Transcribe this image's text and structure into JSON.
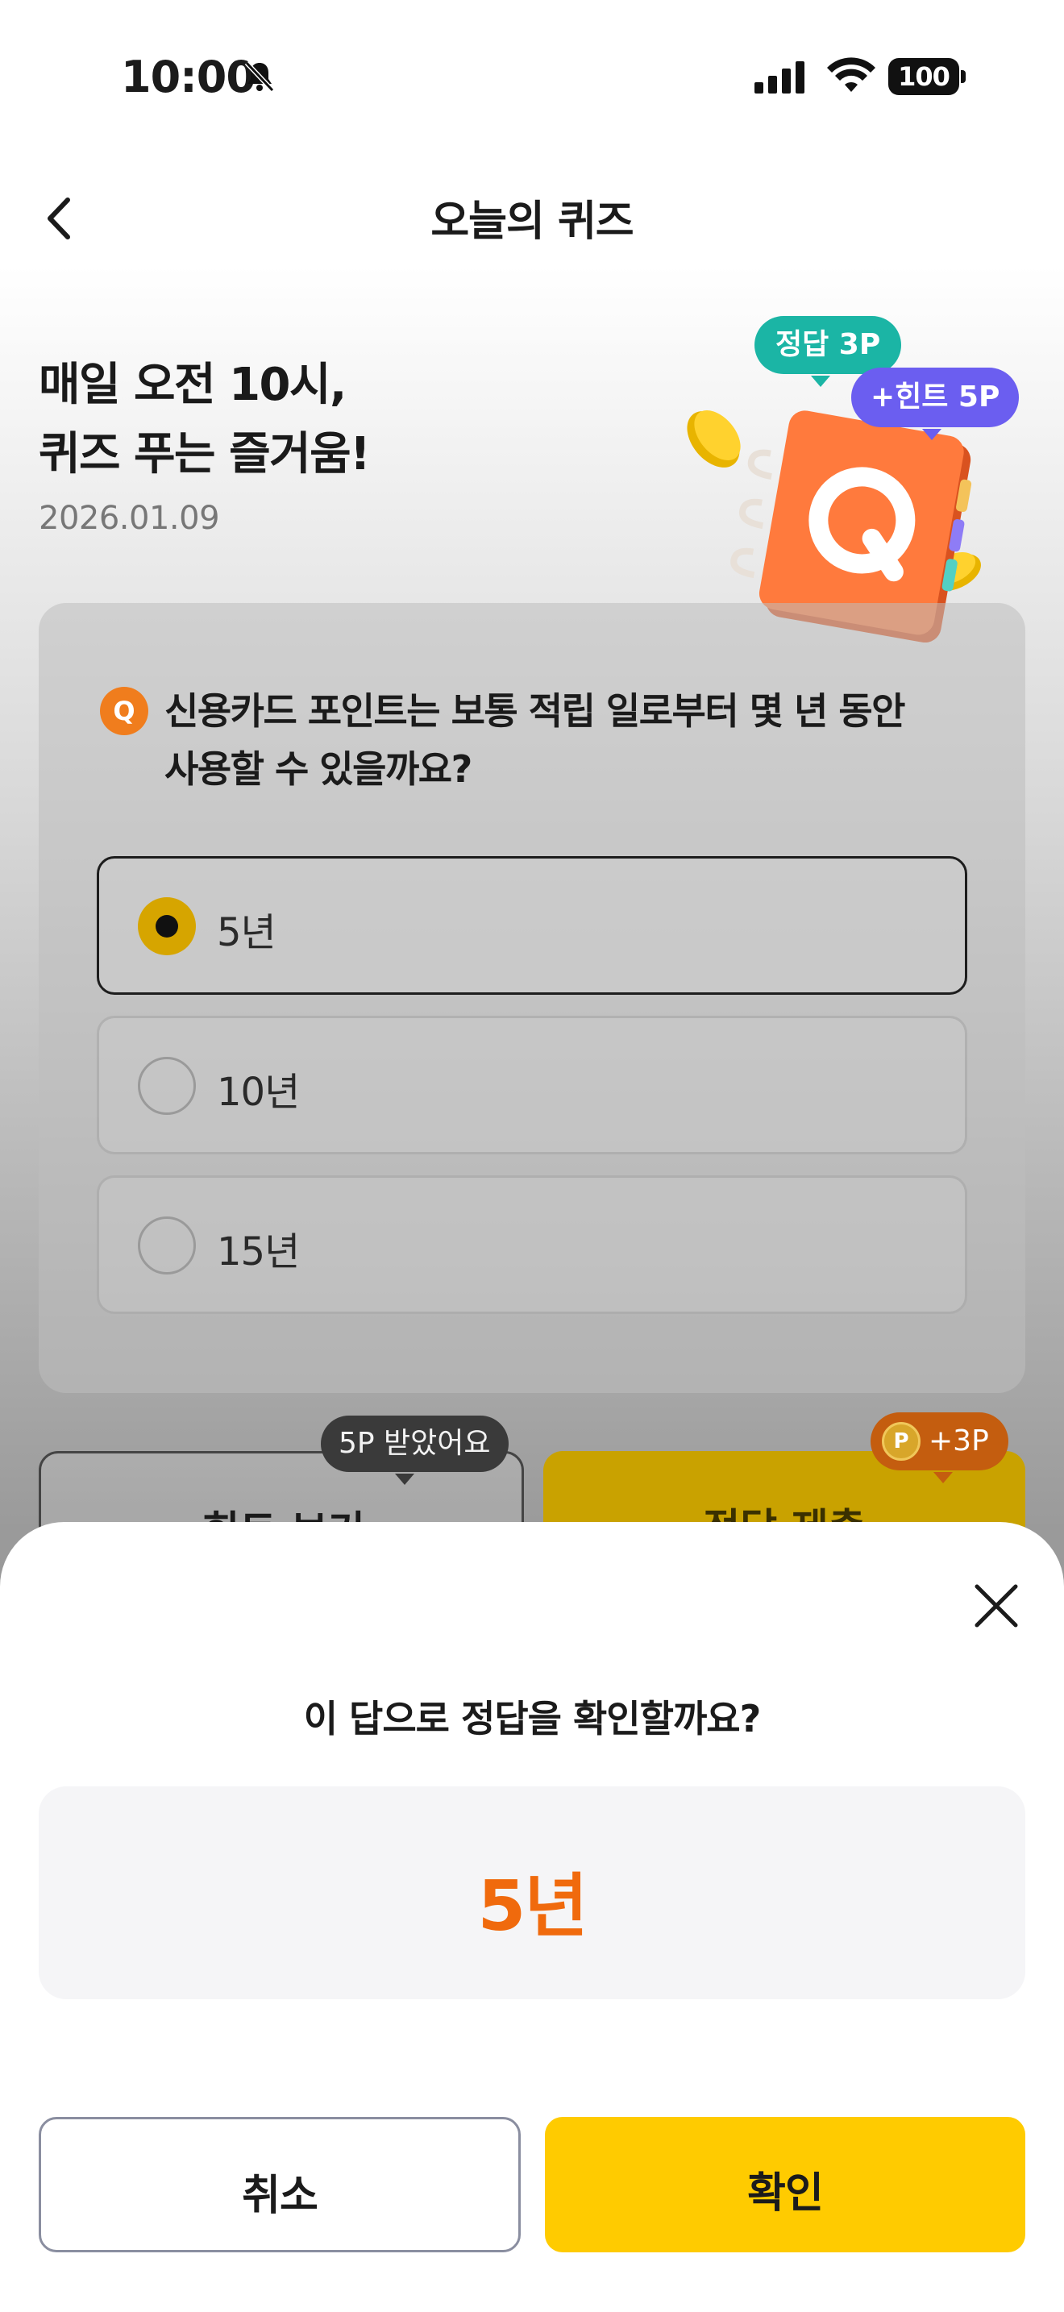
{
  "status_bar": {
    "time": "10:00",
    "battery": "100"
  },
  "header": {
    "title": "오늘의 퀴즈"
  },
  "hero": {
    "line1": "매일 오전 10시,",
    "line2": "퀴즈 푸는 즐거움!",
    "date": "2026.01.09",
    "tip_answer_points": "정답 3P",
    "tip_hint_points": "+힌트 5P"
  },
  "quiz": {
    "badge": "Q",
    "question_line1": "신용카드 포인트는 보통 적립 일로부터 몇 년 동안",
    "question_line2": "사용할 수 있을까요?",
    "options": [
      {
        "label": "5년",
        "selected": true
      },
      {
        "label": "10년",
        "selected": false
      },
      {
        "label": "15년",
        "selected": false
      }
    ]
  },
  "actions": {
    "hint_label": "힌트 보기",
    "hint_tooltip": "5P 받았어요",
    "submit_label": "정답 제출",
    "submit_tooltip": "+3P",
    "coin_letter": "P"
  },
  "sheet": {
    "question": "이 답으로 정답을 확인할까요?",
    "answer": "5년",
    "cancel_label": "취소",
    "confirm_label": "확인"
  },
  "colors": {
    "accent_yellow": "#ffcb00",
    "answer_orange": "#f06a0d",
    "tip_green": "#1bb5a5",
    "tip_purple": "#6b5ef0"
  }
}
